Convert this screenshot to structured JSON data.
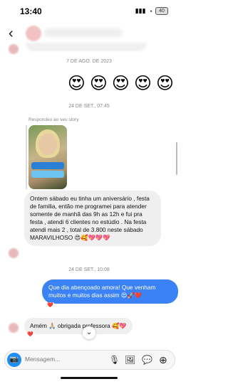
{
  "status_bar": {
    "time": "13:40",
    "signal": "▮▮▮",
    "wifi": "◔",
    "battery": "40"
  },
  "header": {
    "back_icon": "‹",
    "contact_name": "andreaprotagonista"
  },
  "dates": [
    "7 DE AGO. DE 2023",
    "24 DE SET., 07:45",
    "24 DE SET., 10:08"
  ],
  "emoji_reaction": [
    "😍",
    "😍",
    "😍",
    "😍",
    "😍"
  ],
  "story": {
    "label": "Respondeu ao seu story"
  },
  "messages": [
    {
      "from": "contact",
      "text": "Ontem sábado  eu tinha um aniversário , festa de familia, então me programei para atender somente de manhã das 9h as 12h e fui pra festa , atendi 6 clientes no estúdio . Na festa atendi mais 2 , total de 3.800 neste sábado MARAVILHOSO 😍🥰💖💖💖"
    },
    {
      "from": "me",
      "text": "Que dia abençoado amora! Que venham muitos e muitos dias assim 😍🚀❤️",
      "reaction": "❤️"
    },
    {
      "from": "contact",
      "text": "Amém 🙏🏼 obrigada professora 🥰💖",
      "reaction": "❤️"
    }
  ],
  "composer": {
    "placeholder": "Mensagem...",
    "camera_icon": "📷",
    "mic_icon": "🎙",
    "gallery_icon": "🖼",
    "sticker_icon": "💬",
    "plus_icon": "⊕"
  },
  "scroll_down_icon": "⌄"
}
